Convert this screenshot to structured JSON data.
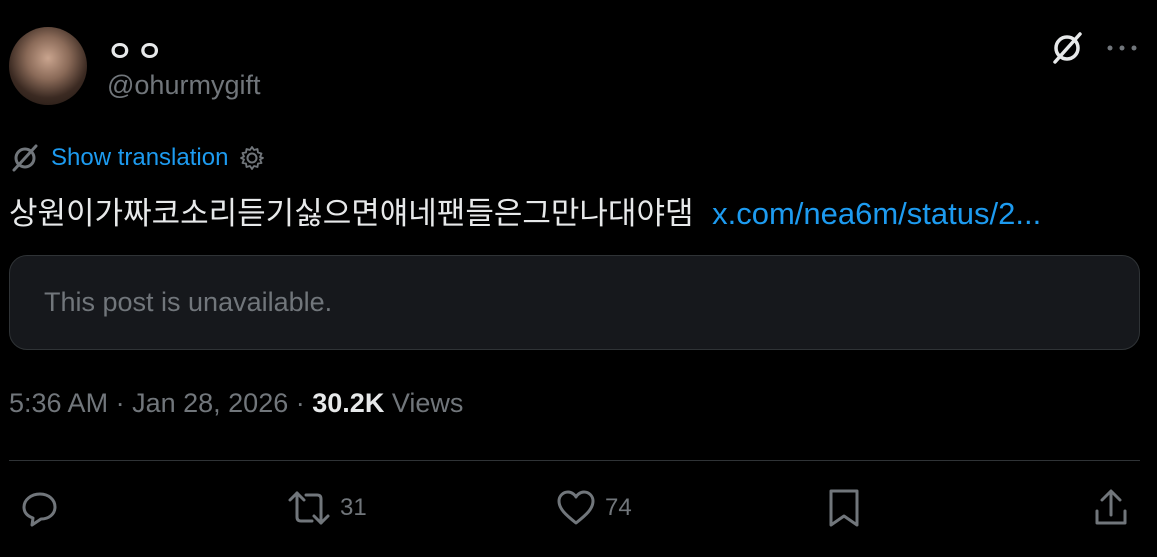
{
  "author": {
    "display_name": "ㅇㅇ",
    "handle": "@ohurmygift"
  },
  "translation": {
    "label": "Show translation"
  },
  "tweet": {
    "text": "상원이가짜코소리듣기싫으면얘네팬들은그만나대야댐",
    "link": "x.com/nea6m/status/2..."
  },
  "quote": {
    "message": "This post is unavailable."
  },
  "meta": {
    "time": "5:36 AM",
    "separator1": "·",
    "date": "Jan 28, 2026",
    "separator2": "·",
    "views_count": "30.2K",
    "views_label": "Views"
  },
  "actions": {
    "reply_count": "",
    "retweet_count": "31",
    "like_count": "74",
    "bookmark_count": "",
    "share_count": ""
  },
  "icons": {
    "grok": "grok-icon",
    "more": "more-icon",
    "translate": "translate-icon",
    "settings": "gear-icon",
    "reply": "reply-icon",
    "retweet": "retweet-icon",
    "like": "heart-icon",
    "bookmark": "bookmark-icon",
    "share": "share-icon"
  },
  "colors": {
    "background": "#000000",
    "text": "#e7e9ea",
    "secondary": "#71767b",
    "link": "#1d9bf0",
    "border": "#2f3336"
  }
}
